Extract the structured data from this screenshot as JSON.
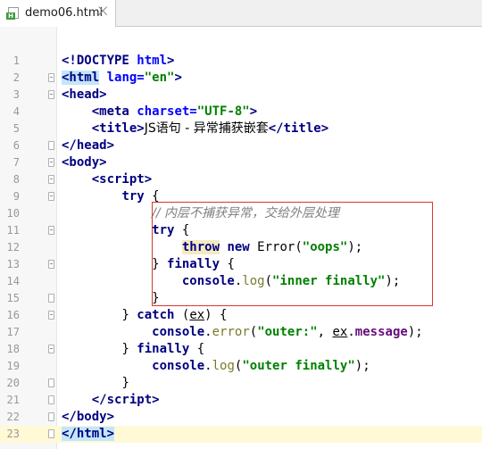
{
  "tab": {
    "title": "demo06.html",
    "close_glyph": "⨉",
    "icon": "html-file-icon",
    "badge": "H"
  },
  "colors": {
    "tag": "#000080",
    "attribute": "#0000ff",
    "string": "#008000",
    "comment": "#808080",
    "highlight_box": "#d9362b"
  },
  "lines": [
    {
      "num": "1",
      "t": [
        "<!DOCTYPE ",
        "html",
        ">"
      ]
    },
    {
      "num": "2",
      "t": [
        "<html",
        " lang=",
        "\"en\"",
        ">"
      ]
    },
    {
      "num": "3",
      "t": [
        "<head",
        ">"
      ]
    },
    {
      "num": "4",
      "t": [
        "<meta",
        " charset=",
        "\"UTF-8\"",
        ">"
      ]
    },
    {
      "num": "5",
      "t": [
        "<title",
        ">",
        "JS语句 - 异常捕获嵌套",
        "</title",
        ">"
      ]
    },
    {
      "num": "6",
      "t": [
        "</head",
        ">"
      ]
    },
    {
      "num": "7",
      "t": [
        "<body",
        ">"
      ]
    },
    {
      "num": "8",
      "t": [
        "<script",
        ">"
      ]
    },
    {
      "num": "9",
      "t": [
        "try",
        " {"
      ]
    },
    {
      "num": "10",
      "t": [
        "// 内层不捕获异常，交给外层处理"
      ]
    },
    {
      "num": "11",
      "t": [
        "try",
        " {"
      ]
    },
    {
      "num": "12",
      "t": [
        "throw",
        " ",
        "new",
        " Error(",
        "\"oops\"",
        ");"
      ]
    },
    {
      "num": "13",
      "t": [
        "} ",
        "finally",
        " {"
      ]
    },
    {
      "num": "14",
      "t": [
        "console",
        ".",
        "log",
        "(",
        "\"inner finally\"",
        ");"
      ]
    },
    {
      "num": "15",
      "t": [
        "}"
      ]
    },
    {
      "num": "16",
      "t": [
        "} ",
        "catch",
        " (",
        "ex",
        ") {"
      ]
    },
    {
      "num": "17",
      "t": [
        "console",
        ".",
        "error",
        "(",
        "\"outer:\"",
        ", ",
        "ex",
        ".",
        "message",
        ");"
      ]
    },
    {
      "num": "18",
      "t": [
        "} ",
        "finally",
        " {"
      ]
    },
    {
      "num": "19",
      "t": [
        "console",
        ".",
        "log",
        "(",
        "\"outer finally\"",
        ");"
      ]
    },
    {
      "num": "20",
      "t": [
        "}"
      ]
    },
    {
      "num": "21",
      "t": [
        "</script",
        ">"
      ]
    },
    {
      "num": "22",
      "t": [
        "</body",
        ">"
      ]
    },
    {
      "num": "23",
      "t": [
        "</html",
        ">"
      ]
    }
  ]
}
